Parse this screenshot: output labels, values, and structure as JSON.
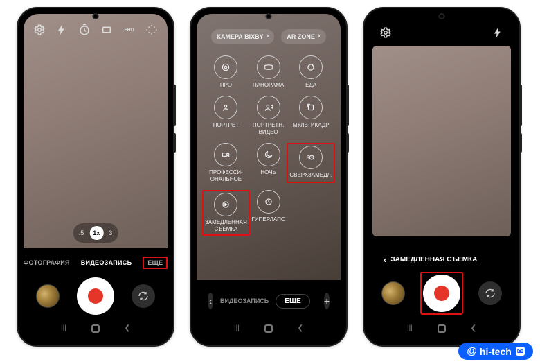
{
  "phone1": {
    "icons": [
      "settings-icon",
      "flash-icon",
      "timer-icon",
      "ratio-icon",
      "resolution-icon",
      "filters-icon"
    ],
    "zoom": {
      "low": ".5",
      "current": "1x",
      "high": "3"
    },
    "modes": {
      "photo": "ФОТОГРАФИЯ",
      "video": "ВИДЕОЗАПИСЬ",
      "more": "ЕЩЕ"
    }
  },
  "phone2": {
    "pill_left": "КАМЕРА BIXBY",
    "pill_right": "AR ZONE",
    "grid": [
      {
        "label": "ПРО"
      },
      {
        "label": "ПАНОРАМА"
      },
      {
        "label": "ЕДА"
      },
      {
        "label": "ПОРТРЕТ"
      },
      {
        "label": "ПОРТРЕТН.\nВИДЕО"
      },
      {
        "label": "МУЛЬТИКАДР"
      },
      {
        "label": "ПРОФЕССИ-\nОНАЛЬНОЕ"
      },
      {
        "label": "НОЧЬ"
      },
      {
        "label": "СВЕРХЗАМЕДЛ."
      },
      {
        "label": "ЗАМЕДЛЕННАЯ\nСЪЕМКА"
      },
      {
        "label": "ГИПЕРЛАПС"
      }
    ],
    "bottom": {
      "video": "ВИДЕОЗАПИСЬ",
      "more": "ЕЩЕ"
    }
  },
  "phone3": {
    "title": "ЗАМЕДЛЕННАЯ СЪЕМКА",
    "icons": [
      "settings-icon",
      "flash-icon"
    ]
  },
  "watermark": "hi-tech"
}
